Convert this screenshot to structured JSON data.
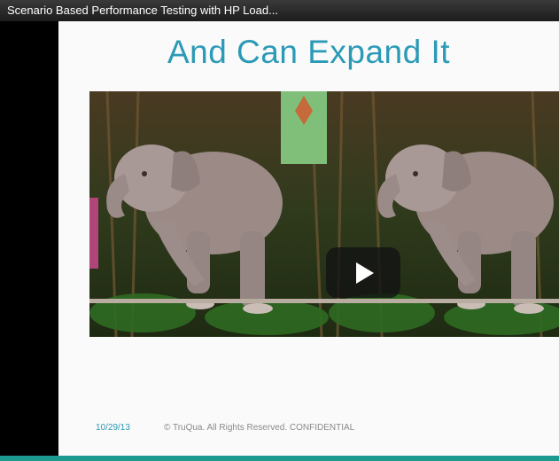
{
  "video": {
    "title": "Scenario Based Performance Testing with HP Load..."
  },
  "slide": {
    "heading": "And Can Expand It",
    "footer_date": "10/29/13",
    "footer_copyright": "© TruQua. All Rights Reserved. CONFIDENTIAL"
  },
  "colors": {
    "accent": "#2b9ab6",
    "bottom_bar": "#1c9a90"
  },
  "icons": {
    "play": "play-icon"
  }
}
